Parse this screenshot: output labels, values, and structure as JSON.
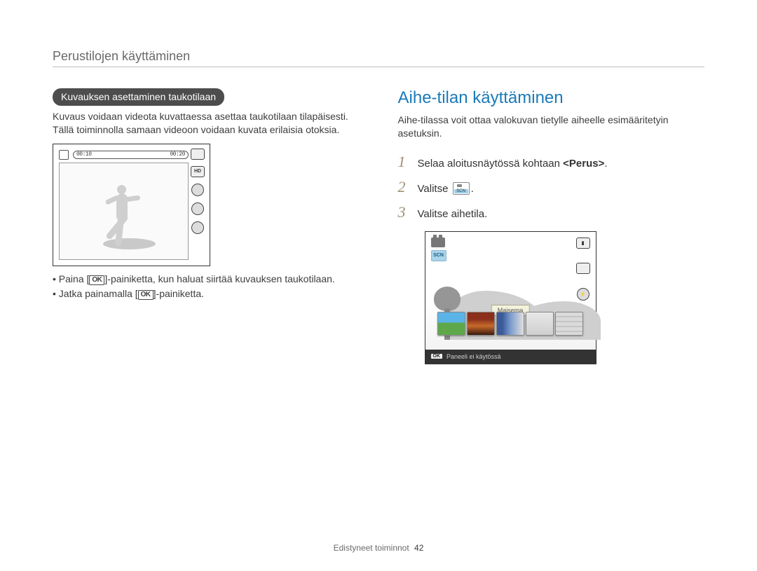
{
  "chapter": "Perustilojen käyttäminen",
  "ok_label": "OK",
  "left": {
    "pill": "Kuvauksen asettaminen taukotilaan",
    "para": "Kuvaus voidaan videota kuvattaessa asettaa taukotilaan tilapäisesti. Tällä toiminnolla samaan videoon voidaan kuvata erilaisia otoksia.",
    "time_start": "00:10",
    "time_end": "00:20",
    "side_icons": {
      "hd": "HD"
    },
    "bullets": {
      "b1_pre": "Paina [",
      "b1_post": "]-painiketta, kun haluat siirtää kuvauksen taukotilaan.",
      "b2_pre": "Jatka painamalla [",
      "b2_post": "]-painiketta."
    }
  },
  "right": {
    "title": "Aihe-tilan käyttäminen",
    "para": "Aihe-tilassa voit ottaa valokuvan tietylle aiheelle esimääritetyin asetuksin.",
    "steps": {
      "s1_pre": "Selaa aloitusnäytössä kohtaan ",
      "s1_bold": "<Perus>",
      "s1_post": ".",
      "s2_pre": "Valitse ",
      "s2_post": ".",
      "s3": "Valitse aihetila."
    },
    "screenshot": {
      "scn_label": "SCN",
      "tooltip": "Maisema",
      "panel_text": "Paneeli ei käytössä"
    }
  },
  "footer": {
    "label": "Edistyneet toiminnot",
    "page": "42"
  }
}
